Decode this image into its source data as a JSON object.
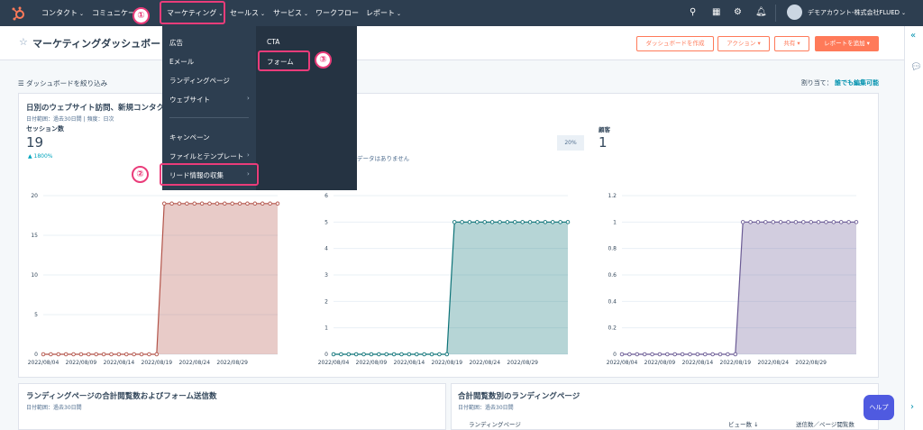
{
  "nav": {
    "items": [
      {
        "label": "コンタクト"
      },
      {
        "label": "コミュニケーション"
      },
      {
        "label": "マーケティング"
      },
      {
        "label": "セールス"
      },
      {
        "label": "サービス"
      },
      {
        "label": "ワークフロー"
      },
      {
        "label": "レポート"
      }
    ],
    "account": "デモアカウント-株式会社FLUED"
  },
  "annotations": {
    "one": "①",
    "two": "②",
    "three": "③"
  },
  "menu": {
    "left": [
      {
        "label": "広告"
      },
      {
        "label": "Eメール"
      },
      {
        "label": "ランディングページ"
      },
      {
        "label": "ウェブサイト"
      },
      {
        "label": "キャンペーン"
      },
      {
        "label": "ファイルとテンプレート"
      },
      {
        "label": "リード情報の収集"
      }
    ],
    "right": [
      {
        "label": "CTA"
      },
      {
        "label": "フォーム"
      }
    ]
  },
  "header": {
    "title": "マーケティングダッシュボード",
    "buttons": {
      "create": "ダッシュボードを作成",
      "actions": "アクション",
      "share": "共有",
      "add_report": "レポートを追加"
    }
  },
  "filter": {
    "label": "ダッシュボードを絞り込み",
    "assign_label": "割り当て：",
    "assign_value": "誰でも編集可能"
  },
  "card1": {
    "title": "日別のウェブサイト訪問、新規コンタクト",
    "subtitle": "日付範囲：過去30日間 | 頻度：日次",
    "metric_label": "セッション数",
    "metric_value": "19",
    "metric_change": "▲ 1800%",
    "mid_tag": "20%",
    "no_data": "データはありません",
    "right_label": "顧客",
    "right_value": "1"
  },
  "card2": {
    "title": "ランディングページの合計閲覧数およびフォーム送信数",
    "subtitle": "日付範囲：過去30日間"
  },
  "card3": {
    "title": "合計閲覧数別のランディングページ",
    "subtitle": "日付範囲：過去30日間",
    "columns": {
      "page": "ランディングページ",
      "views": "ビュー数 ↓",
      "ratio": "送信数／ページ閲覧数"
    }
  },
  "help": "ヘルプ",
  "colors": {
    "nav": "#2d3e50",
    "accent": "#ff7a59",
    "highlight": "#ea3c7a",
    "teal": "#00a4bd"
  },
  "chart_data": [
    {
      "type": "area",
      "x": [
        "2022/08/04",
        "2022/08/09",
        "2022/08/14",
        "2022/08/19",
        "2022/08/24",
        "2022/08/29"
      ],
      "yticks": [
        "0",
        "5",
        "10",
        "15",
        "20"
      ],
      "ylim": [
        0,
        20
      ],
      "color": "#b3544a",
      "series": [
        {
          "values": [
            0,
            0,
            0,
            0,
            0,
            0,
            0,
            0,
            0,
            0,
            0,
            0,
            0,
            0,
            0,
            0,
            19,
            19,
            19,
            19,
            19,
            19,
            19,
            19,
            19,
            19,
            19,
            19,
            19,
            19,
            19,
            19
          ]
        }
      ]
    },
    {
      "type": "area",
      "x": [
        "2022/08/04",
        "2022/08/09",
        "2022/08/14",
        "2022/08/19",
        "2022/08/24",
        "2022/08/29"
      ],
      "yticks": [
        "0",
        "1",
        "2",
        "3",
        "4",
        "5",
        "6"
      ],
      "ylim": [
        0,
        6
      ],
      "color": "#0d7378",
      "series": [
        {
          "values": [
            0,
            0,
            0,
            0,
            0,
            0,
            0,
            0,
            0,
            0,
            0,
            0,
            0,
            0,
            0,
            0,
            5,
            5,
            5,
            5,
            5,
            5,
            5,
            5,
            5,
            5,
            5,
            5,
            5,
            5,
            5,
            5
          ]
        }
      ]
    },
    {
      "type": "area",
      "x": [
        "2022/08/04",
        "2022/08/09",
        "2022/08/14",
        "2022/08/19",
        "2022/08/24",
        "2022/08/29"
      ],
      "yticks": [
        "0",
        "0.2",
        "0.4",
        "0.6",
        "0.8",
        "1",
        "1.2"
      ],
      "ylim": [
        0,
        1.2
      ],
      "color": "#6b5b95",
      "series": [
        {
          "values": [
            0,
            0,
            0,
            0,
            0,
            0,
            0,
            0,
            0,
            0,
            0,
            0,
            0,
            0,
            0,
            0,
            1,
            1,
            1,
            1,
            1,
            1,
            1,
            1,
            1,
            1,
            1,
            1,
            1,
            1,
            1,
            1
          ]
        }
      ]
    }
  ]
}
